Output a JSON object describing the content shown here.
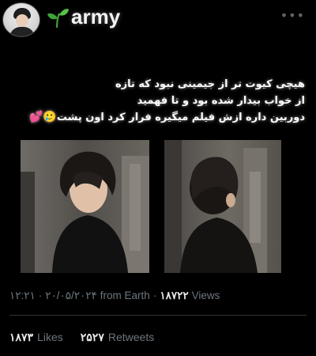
{
  "profile": {
    "handle": "army",
    "avatar_icon": "profile-photo"
  },
  "header": {
    "more_icon": "more-dots-icon",
    "more_glyph": "•••"
  },
  "tweet": {
    "lines": [
      "هیچی کیوت تر از جیمینی نبود که تازه",
      "از خواب بیدار شده بود و تا فهمید",
      "دوربین داره ازش فیلم میگیره فرار کرد اون پشت"
    ],
    "emojis": [
      "🥲",
      "💕"
    ]
  },
  "media": {
    "images": [
      {
        "name": "photo-jimin-facing-down"
      },
      {
        "name": "photo-jimin-turning-away"
      }
    ]
  },
  "meta": {
    "time": "۱۲:۲۱",
    "sep": "·",
    "date": "۲۰/۰۵/۲۰۲۴",
    "source": "from Earth",
    "views_count": "۱۸۷۲۲",
    "views_label": "Views"
  },
  "stats": {
    "likes_count": "۱۸۷۳",
    "likes_label": "Likes",
    "retweets_count": "۲۵۲۷",
    "retweets_label": "Retweets"
  },
  "colors": {
    "background": "#000000",
    "text": "#e7e9ea",
    "muted": "#6e767d"
  }
}
